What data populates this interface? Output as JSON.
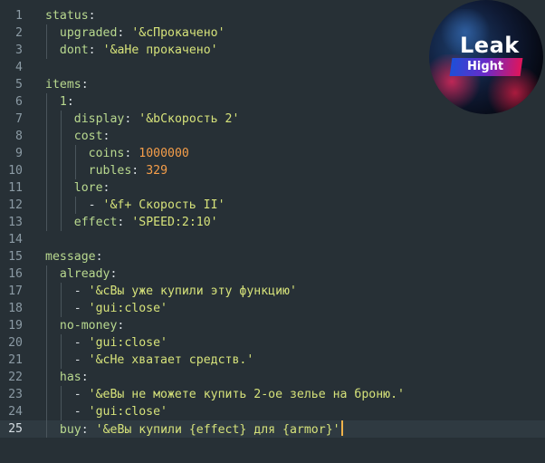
{
  "editor": {
    "current_line": 25,
    "lines": [
      {
        "n": "1",
        "t": "status:"
      },
      {
        "n": "2",
        "t": "  upgraded: '&cПрокачено'"
      },
      {
        "n": "3",
        "t": "  dont: '&aНе прокачено'"
      },
      {
        "n": "4",
        "t": ""
      },
      {
        "n": "5",
        "t": "items:"
      },
      {
        "n": "6",
        "t": "  1:"
      },
      {
        "n": "7",
        "t": "    display: '&bСкорость 2'"
      },
      {
        "n": "8",
        "t": "    cost:"
      },
      {
        "n": "9",
        "t": "      coins: 1000000"
      },
      {
        "n": "10",
        "t": "      rubles: 329"
      },
      {
        "n": "11",
        "t": "    lore:"
      },
      {
        "n": "12",
        "t": "      - '&f+ Скорость II'"
      },
      {
        "n": "13",
        "t": "    effect: 'SPEED:2:10'"
      },
      {
        "n": "14",
        "t": ""
      },
      {
        "n": "15",
        "t": "message:"
      },
      {
        "n": "16",
        "t": "  already:"
      },
      {
        "n": "17",
        "t": "    - '&cВы уже купили эту функцию'"
      },
      {
        "n": "18",
        "t": "    - 'gui:close'"
      },
      {
        "n": "19",
        "t": "  no-money:"
      },
      {
        "n": "20",
        "t": "    - 'gui:close'"
      },
      {
        "n": "21",
        "t": "    - '&cНе хватает средств.'"
      },
      {
        "n": "22",
        "t": "  has:"
      },
      {
        "n": "23",
        "t": "    - '&eВы не можете купить 2-ое зелье на броню.'"
      },
      {
        "n": "24",
        "t": "    - 'gui:close'"
      },
      {
        "n": "25",
        "t": "  buy: '&eВы купили {effect} для {armor}'"
      }
    ]
  },
  "logo": {
    "word1": "Leak",
    "word2": "Hight"
  }
}
